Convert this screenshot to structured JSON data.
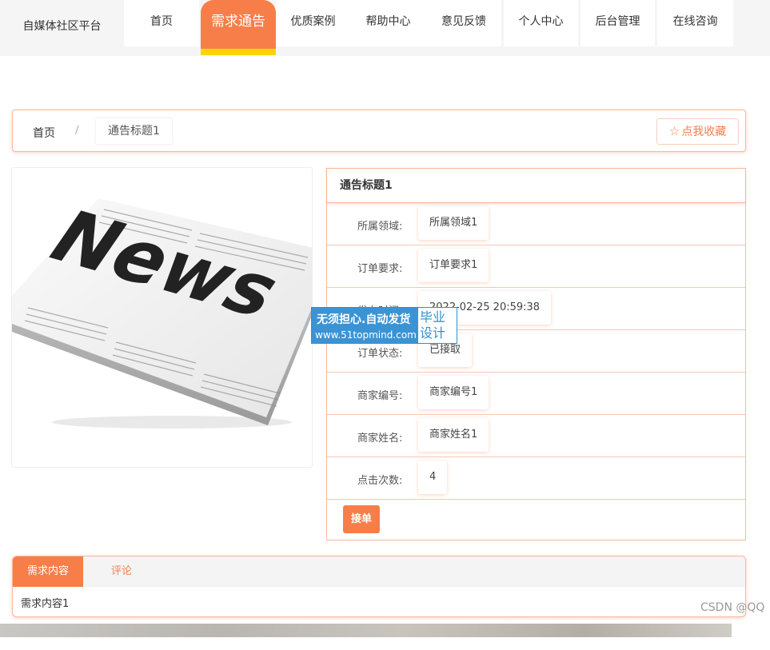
{
  "brand": "自媒体社区平台",
  "nav": [
    {
      "label": "首页"
    },
    {
      "label": "需求通告"
    },
    {
      "label": "优质案例"
    },
    {
      "label": "帮助中心"
    },
    {
      "label": "意见反馈"
    },
    {
      "label": "个人中心"
    },
    {
      "label": "后台管理"
    },
    {
      "label": "在线咨询"
    }
  ],
  "breadcrumb": {
    "home": "首页",
    "separator": "/",
    "current": "通告标题1"
  },
  "favorite_label": "点我收藏",
  "image": {
    "headline": "News"
  },
  "detail": {
    "title": "通告标题1",
    "rows": [
      {
        "label": "所属领域:",
        "value": "所属领域1"
      },
      {
        "label": "订单要求:",
        "value": "订单要求1"
      },
      {
        "label": "发布时间:",
        "value": "2022-02-25 20:59:38"
      },
      {
        "label": "订单状态:",
        "value": "已接取"
      },
      {
        "label": "商家编号:",
        "value": "商家编号1"
      },
      {
        "label": "商家姓名:",
        "value": "商家姓名1"
      },
      {
        "label": "点击次数:",
        "value": "4"
      }
    ],
    "accept_label": "接单"
  },
  "tabs": [
    {
      "label": "需求内容"
    },
    {
      "label": "评论"
    }
  ],
  "tab_content": "需求内容1",
  "watermark": {
    "line1": "无须担心.自动发货",
    "line2": "www.51topmind.com",
    "right": "毕业设计"
  },
  "csdn": "CSDN @QQ",
  "colors": {
    "accent": "#f77e49",
    "active_underline": "#ffd400",
    "border": "#f9b89b",
    "watermark_blue": "#3a93d4"
  }
}
